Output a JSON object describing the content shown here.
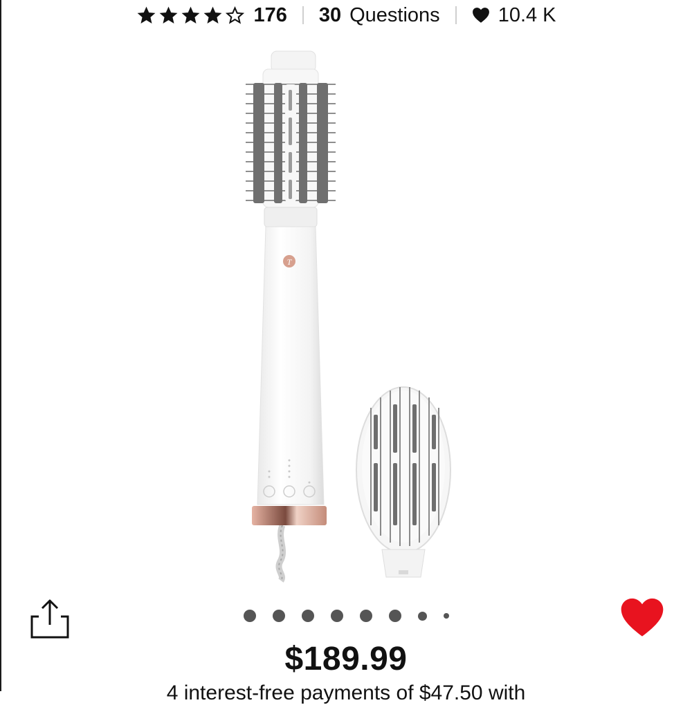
{
  "rating": {
    "stars_filled": 4,
    "stars_total": 5,
    "review_count": "176"
  },
  "questions": {
    "count": "30",
    "label": "Questions"
  },
  "loves": {
    "count": "10.4 K"
  },
  "carousel": {
    "total": 8,
    "active_index": 0
  },
  "price": "$189.99",
  "installments_text": "4 interest-free payments of $47.50 with",
  "colors": {
    "favorite": "#e8131f",
    "text": "#111111",
    "rose_gold": "#c98f7e"
  },
  "icons": {
    "share": "share-icon",
    "favorite": "heart-icon",
    "star": "star-icon"
  }
}
